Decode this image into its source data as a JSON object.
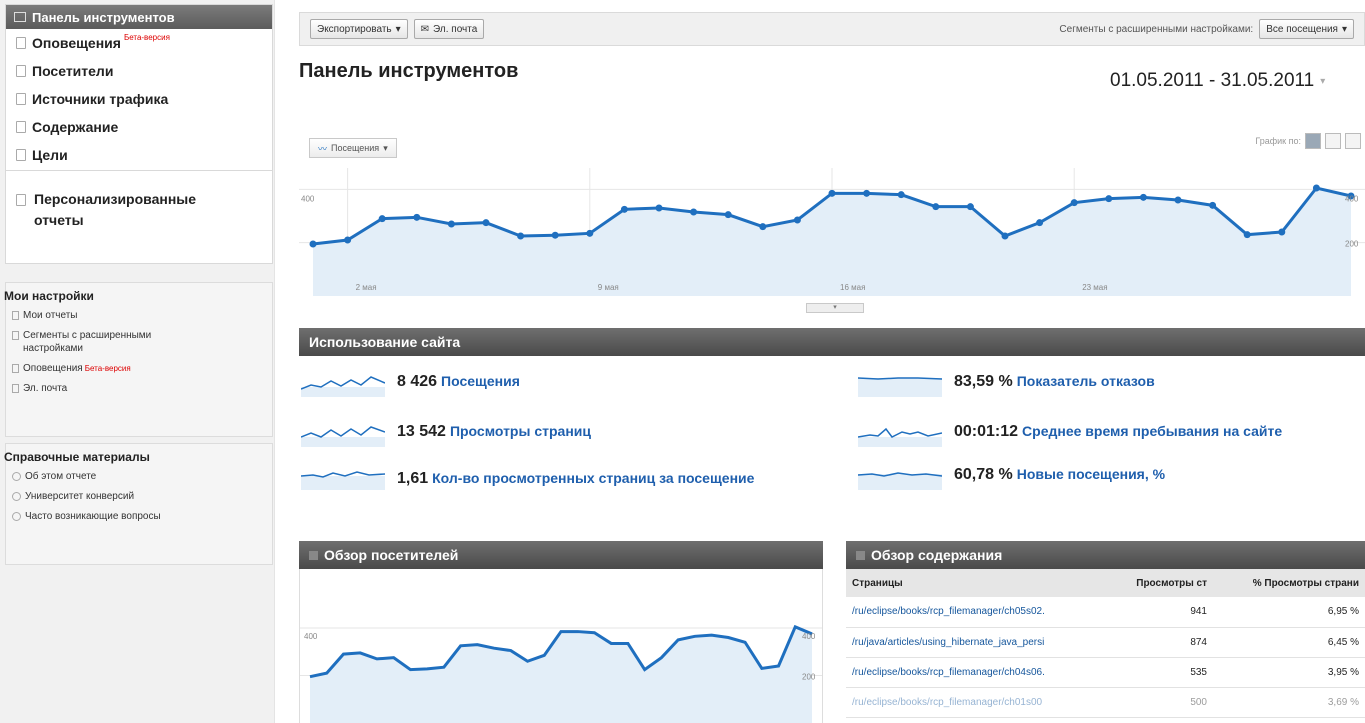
{
  "sidebar": {
    "active_item": "Панель инструментов",
    "items": [
      {
        "label": "Оповещения",
        "beta": "Бета-версия"
      },
      {
        "label": "Посетители"
      },
      {
        "label": "Источники трафика"
      },
      {
        "label": "Содержание"
      },
      {
        "label": "Цели"
      }
    ],
    "custom_reports": "Персонализированные отчеты",
    "my_settings": {
      "title": "Мои настройки",
      "links": [
        "Мои отчеты",
        "Сегменты с расширенными настройками",
        "Оповещения",
        "Эл. почта"
      ],
      "beta": "Бета-версия"
    },
    "help": {
      "title": "Справочные материалы",
      "links": [
        "Об этом отчете",
        "Университет конверсий",
        "Часто возникающие вопросы"
      ]
    }
  },
  "toolbar": {
    "export_label": "Экспортировать",
    "email_label": "Эл. почта",
    "segments_label": "Сегменты с расширенными настройками:",
    "segments_value": "Все посещения"
  },
  "page_title": "Панель инструментов",
  "date_range": "01.05.2011 - 31.05.2011",
  "graph_by_label": "График по:",
  "metric_selector": "Посещения",
  "chart_data": {
    "type": "line",
    "x_ticks": [
      "2 мая",
      "9 мая",
      "16 мая",
      "23 мая"
    ],
    "y_ticks": [
      "400",
      "200"
    ],
    "ylim": [
      0,
      480
    ],
    "values": [
      195,
      210,
      290,
      295,
      270,
      275,
      225,
      228,
      235,
      325,
      330,
      315,
      305,
      260,
      285,
      385,
      385,
      380,
      335,
      335,
      225,
      275,
      350,
      365,
      370,
      360,
      340,
      230,
      240,
      405,
      375
    ]
  },
  "site_usage": {
    "title": "Использование сайта",
    "metrics": [
      {
        "value": "8 426",
        "label": "Посещения"
      },
      {
        "value": "13 542",
        "label": "Просмотры страниц"
      },
      {
        "value": "1,61",
        "label": "Кол-во просмотренных страниц за посещение"
      },
      {
        "value": "83,59 %",
        "label": "Показатель отказов"
      },
      {
        "value": "00:01:12",
        "label": "Среднее время пребывания на сайте"
      },
      {
        "value": "60,78 %",
        "label": "Новые посещения, %"
      }
    ]
  },
  "visitors_overview": {
    "title": "Обзор посетителей",
    "y_ticks": [
      "400",
      "200"
    ]
  },
  "content_overview": {
    "title": "Обзор содержания",
    "columns": [
      "Страницы",
      "Просмотры ст",
      "% Просмотры страни"
    ],
    "rows": [
      [
        "/ru/eclipse/books/rcp_filemanager/ch05s02.",
        "941",
        "6,95 %"
      ],
      [
        "/ru/java/articles/using_hibernate_java_persi",
        "874",
        "6,45 %"
      ],
      [
        "/ru/eclipse/books/rcp_filemanager/ch04s06.",
        "535",
        "3,95 %"
      ],
      [
        "/ru/eclipse/books/rcp_filemanager/ch01s00",
        "500",
        "3,69 %"
      ]
    ]
  },
  "colors": {
    "line": "#1f6fbf",
    "fill": "#e3eef8",
    "bar": "#555555"
  }
}
